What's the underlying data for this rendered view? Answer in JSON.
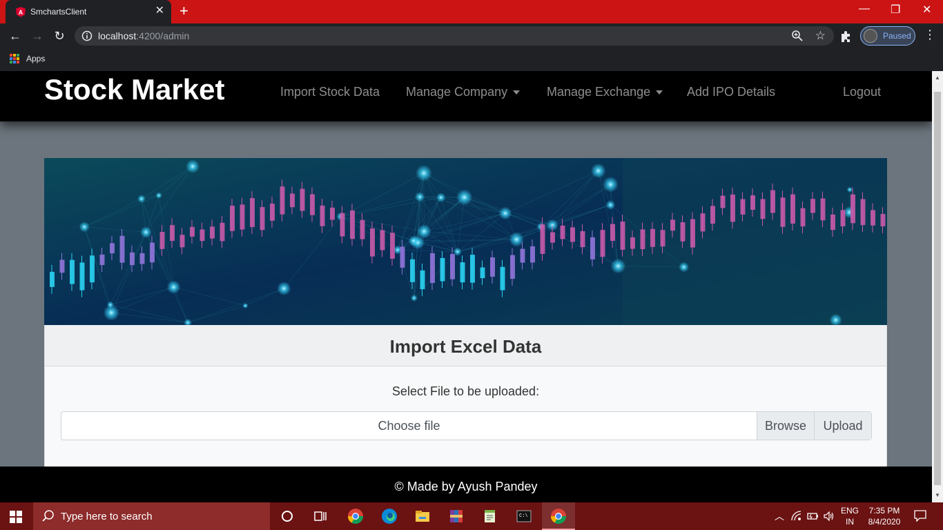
{
  "browser": {
    "tab_title": "SmchartsClient",
    "url_host": "localhost",
    "url_path": ":4200/admin",
    "profile_status": "Paused",
    "bookmarks_apps": "Apps"
  },
  "navbar": {
    "brand": "Stock Market",
    "links": [
      {
        "label": "Import Stock Data"
      },
      {
        "label": "Manage Company"
      },
      {
        "label": "Manage Exchange"
      },
      {
        "label": "Add IPO Details"
      },
      {
        "label": "Logout"
      }
    ]
  },
  "import_card": {
    "title": "Import Excel Data",
    "prompt": "Select File to be uploaded:",
    "file_placeholder": "Choose file",
    "browse_label": "Browse",
    "upload_label": "Upload"
  },
  "footer": {
    "text": "© Made by Ayush Pandey"
  },
  "taskbar": {
    "search_placeholder": "Type here to search",
    "lang_top": "ENG",
    "lang_bottom": "IN",
    "time": "7:35 PM",
    "date": "8/4/2020"
  },
  "colors": {
    "tabbar": "#cc1414",
    "taskbar": "#6b1212",
    "page_bg": "#6c757d",
    "navbar": "#000000"
  }
}
